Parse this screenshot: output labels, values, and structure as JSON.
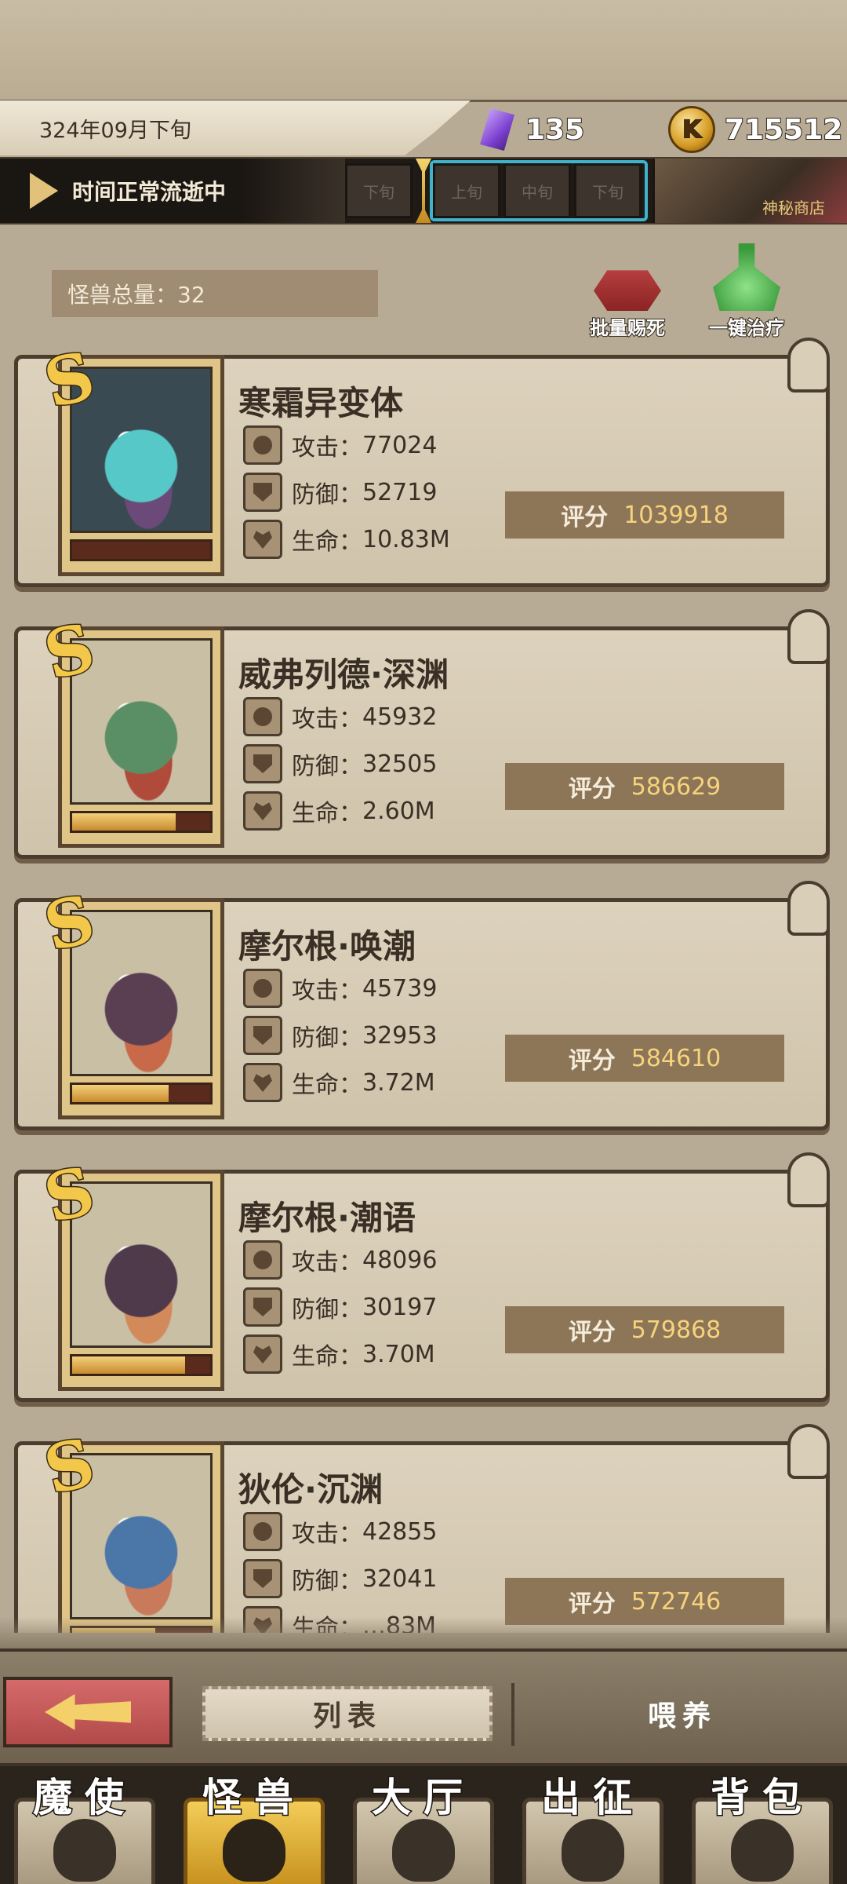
{
  "top_bar": {
    "date": "324年09月下旬",
    "crystals": "135",
    "coins": "715512"
  },
  "time_bar": {
    "status": "时间正常流逝中",
    "slots": [
      "下旬",
      "上旬",
      "中旬",
      "下旬"
    ],
    "shop_label": "神秘商店"
  },
  "header": {
    "total_label": "怪兽总量：32",
    "batch_kill_label": "批量赐死",
    "heal_all_label": "一键治疗"
  },
  "stat_labels": {
    "attack": "攻击：",
    "defense": "防御：",
    "life": "生命："
  },
  "score_label": "评分",
  "monsters": [
    {
      "grade": "S",
      "name": "寒霜异变体",
      "attack": "77024",
      "defense": "52719",
      "life": "10.83M",
      "score": "1039918",
      "bar_fill": 0.0,
      "colors": [
        "#3a4a52",
        "#56c8c8",
        "#6b4a7a"
      ]
    },
    {
      "grade": "S",
      "name": "威弗列德·深渊",
      "attack": "45932",
      "defense": "32505",
      "life": "2.60M",
      "score": "586629",
      "bar_fill": 0.75,
      "colors": [
        "#c9bfa5",
        "#5a8f66",
        "#b04a3a"
      ]
    },
    {
      "grade": "S",
      "name": "摩尔根·唤潮",
      "attack": "45739",
      "defense": "32953",
      "life": "3.72M",
      "score": "584610",
      "bar_fill": 0.7,
      "colors": [
        "#c9bfa5",
        "#5a3f52",
        "#c86a4a"
      ]
    },
    {
      "grade": "S",
      "name": "摩尔根·潮语",
      "attack": "48096",
      "defense": "30197",
      "life": "3.70M",
      "score": "579868",
      "bar_fill": 0.82,
      "colors": [
        "#c9bfa5",
        "#4e3a4a",
        "#d28a5a"
      ]
    },
    {
      "grade": "S",
      "name": "狄伦·沉渊",
      "attack": "42855",
      "defense": "32041",
      "life": "…83M",
      "score": "572746",
      "bar_fill": 0.6,
      "colors": [
        "#c9bfa5",
        "#4a76a8",
        "#c87a5a"
      ]
    }
  ],
  "sub_nav": {
    "list_tab": "列表",
    "feed_tab": "喂养"
  },
  "main_nav": [
    {
      "label": "魔使",
      "active": false
    },
    {
      "label": "怪兽",
      "active": true
    },
    {
      "label": "大厅",
      "active": false
    },
    {
      "label": "出征",
      "active": false
    },
    {
      "label": "背包",
      "active": false
    }
  ]
}
